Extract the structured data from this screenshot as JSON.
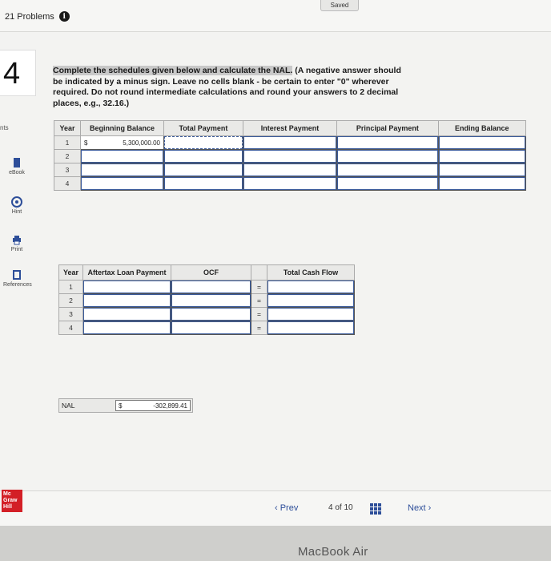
{
  "header": {
    "problems_label": "21 Problems",
    "saved_label": "Saved"
  },
  "question": {
    "number": "4",
    "instructions_highlight": "Complete the schedules given below and calculate the NAL.",
    "instructions_rest": " (A negative answer should be indicated by a minus sign. Leave no cells blank - be certain to enter \"0\" wherever required. Do not round intermediate calculations and round your answers to 2 decimal places, e.g., 32.16.)"
  },
  "sidebar": {
    "points_label": "nts",
    "items": [
      {
        "label": "eBook",
        "icon": "book-icon"
      },
      {
        "label": "Hint",
        "icon": "hint-icon"
      },
      {
        "label": "Print",
        "icon": "print-icon"
      },
      {
        "label": "References",
        "icon": "references-icon"
      }
    ]
  },
  "loan_schedule": {
    "headers": [
      "Year",
      "Beginning Balance",
      "Total Payment",
      "Interest Payment",
      "Principal Payment",
      "Ending Balance"
    ],
    "years": [
      "1",
      "2",
      "3",
      "4"
    ],
    "currency_symbol": "$",
    "beginning_balance_year1": "5,300,000.00"
  },
  "cashflow_schedule": {
    "headers": [
      "Year",
      "Aftertax Loan Payment",
      "OCF",
      "Total Cash Flow"
    ],
    "years": [
      "1",
      "2",
      "3",
      "4"
    ],
    "equals": "="
  },
  "nal": {
    "label": "NAL",
    "currency_symbol": "$",
    "value": "-302,899.41"
  },
  "footer": {
    "logo_text": "Mc Graw Hill",
    "prev_label": "‹  Prev",
    "page_label": "4 of 10",
    "next_label": "Next  ›"
  },
  "device_label": "MacBook Air"
}
